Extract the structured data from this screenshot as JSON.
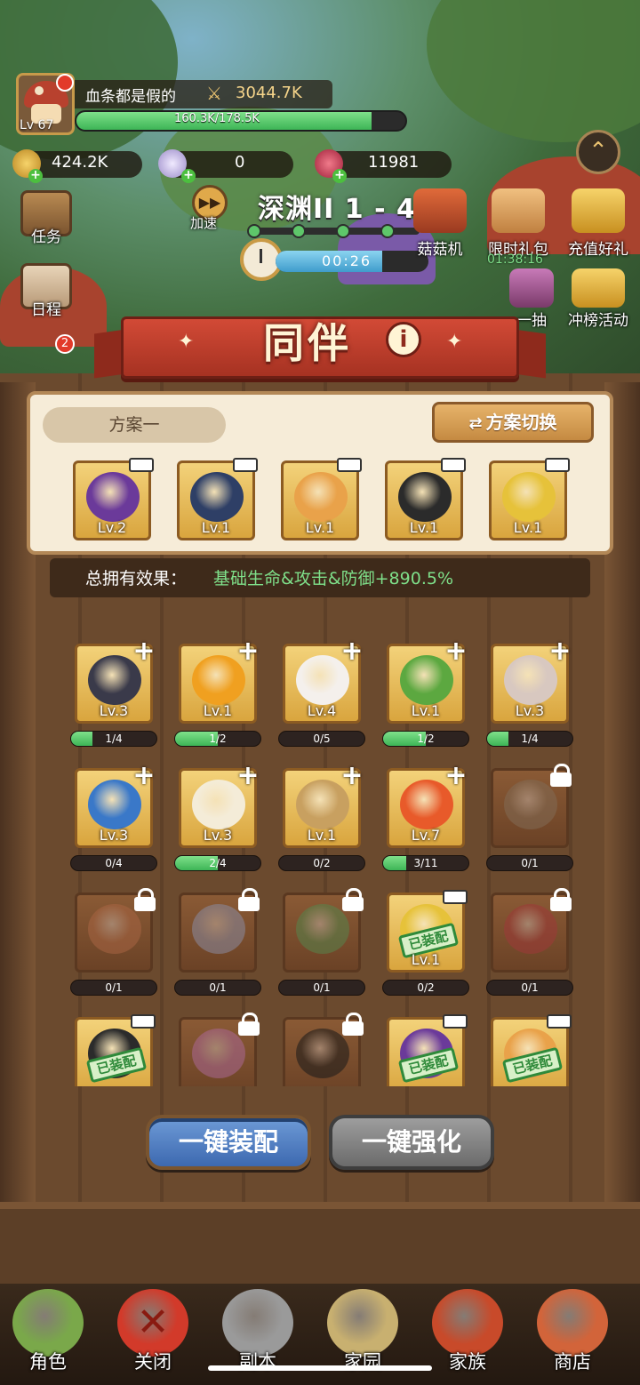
{
  "player": {
    "name": "血条都是假的",
    "level": "Lv 67",
    "power": "3044.7K",
    "hp_text": "160.3K/178.5K",
    "hp_fraction": 0.898
  },
  "currencies": {
    "gold": "424.2K",
    "crystal": "0",
    "gem": "11981"
  },
  "shortcuts": {
    "task": "任务",
    "schedule": "日程",
    "badge_count": "2",
    "speed": "加速"
  },
  "stage": {
    "title": "深渊II  1 - 4",
    "timer": "00:26"
  },
  "events": {
    "mushroom_machine": "菇菇机",
    "limited_gift": "限时礼包",
    "limited_gift_timer": "01:38:16",
    "recharge_gift": "充值好礼",
    "draw_partial": "一抽",
    "ranking": "冲榜活动"
  },
  "panel": {
    "title": "同伴",
    "plan_name": "方案一",
    "plan_switch": "方案切换",
    "effect_label": "总拥有效果：",
    "effect_value": "基础生命&攻击&防御+890.5%"
  },
  "lineup": [
    {
      "level": "Lv.2",
      "color": "#6b3a9a"
    },
    {
      "level": "Lv.1",
      "color": "#2e3f66"
    },
    {
      "level": "Lv.1",
      "color": "#e9a24a"
    },
    {
      "level": "Lv.1",
      "color": "#2b2b2b"
    },
    {
      "level": "Lv.1",
      "color": "#e6c23a"
    }
  ],
  "companions": [
    {
      "level": "Lv.3",
      "progress": "1/4",
      "fraction": 0.25,
      "state": "plus",
      "color": "#3a3a4a"
    },
    {
      "level": "Lv.1",
      "progress": "1/2",
      "fraction": 0.5,
      "state": "plus",
      "color": "#f0a020"
    },
    {
      "level": "Lv.4",
      "progress": "0/5",
      "fraction": 0,
      "state": "plus",
      "color": "#f4f0ec"
    },
    {
      "level": "Lv.1",
      "progress": "1/2",
      "fraction": 0.5,
      "state": "plus",
      "color": "#5ca840"
    },
    {
      "level": "Lv.3",
      "progress": "1/4",
      "fraction": 0.25,
      "state": "plus",
      "color": "#d8c8c0"
    },
    {
      "level": "Lv.3",
      "progress": "0/4",
      "fraction": 0,
      "state": "plus",
      "color": "#3a78c8"
    },
    {
      "level": "Lv.3",
      "progress": "2/4",
      "fraction": 0.5,
      "state": "plus",
      "color": "#f4ecd8"
    },
    {
      "level": "Lv.1",
      "progress": "0/2",
      "fraction": 0,
      "state": "plus",
      "color": "#c8a060"
    },
    {
      "level": "Lv.7",
      "progress": "3/11",
      "fraction": 0.27,
      "state": "plus",
      "color": "#e85a2a"
    },
    {
      "level": "",
      "progress": "0/1",
      "fraction": 0,
      "state": "locked",
      "color": "#8a6a4a"
    },
    {
      "level": "",
      "progress": "0/1",
      "fraction": 0,
      "state": "locked",
      "color": "#c06030"
    },
    {
      "level": "",
      "progress": "0/1",
      "fraction": 0,
      "state": "locked",
      "color": "#8a8aa8"
    },
    {
      "level": "",
      "progress": "0/1",
      "fraction": 0,
      "state": "locked",
      "color": "#4a8a3a"
    },
    {
      "level": "Lv.1",
      "progress": "0/2",
      "fraction": 0,
      "state": "equipped",
      "color": "#e6c23a"
    },
    {
      "level": "",
      "progress": "0/1",
      "fraction": 0,
      "state": "locked",
      "color": "#c03030"
    },
    {
      "level": "",
      "progress": "",
      "fraction": 0,
      "state": "equipped",
      "color": "#2b2b2b"
    },
    {
      "level": "",
      "progress": "",
      "fraction": 0,
      "state": "locked",
      "color": "#c060a0"
    },
    {
      "level": "",
      "progress": "",
      "fraction": 0,
      "state": "locked",
      "color": "#1a1a1a"
    },
    {
      "level": "",
      "progress": "",
      "fraction": 0,
      "state": "equipped",
      "color": "#6b3a9a"
    },
    {
      "level": "",
      "progress": "",
      "fraction": 0,
      "state": "equipped",
      "color": "#e9a24a"
    }
  ],
  "equipped_label": "已装配",
  "actions": {
    "equip_all": "一键装配",
    "upgrade_all": "一键强化"
  },
  "nav": [
    {
      "label": "角色",
      "icon": "mushroom-character-icon",
      "color": "#7aa84a"
    },
    {
      "label": "关闭",
      "icon": "close-icon",
      "color": "#d23a2a"
    },
    {
      "label": "副本",
      "icon": "crossed-swords-icon",
      "color": "#9a9a9a"
    },
    {
      "label": "家园",
      "icon": "home-garden-icon",
      "color": "#c8b070"
    },
    {
      "label": "家族",
      "icon": "skull-banner-icon",
      "color": "#c84a2a"
    },
    {
      "label": "商店",
      "icon": "shop-icon",
      "color": "#d2643a"
    }
  ]
}
